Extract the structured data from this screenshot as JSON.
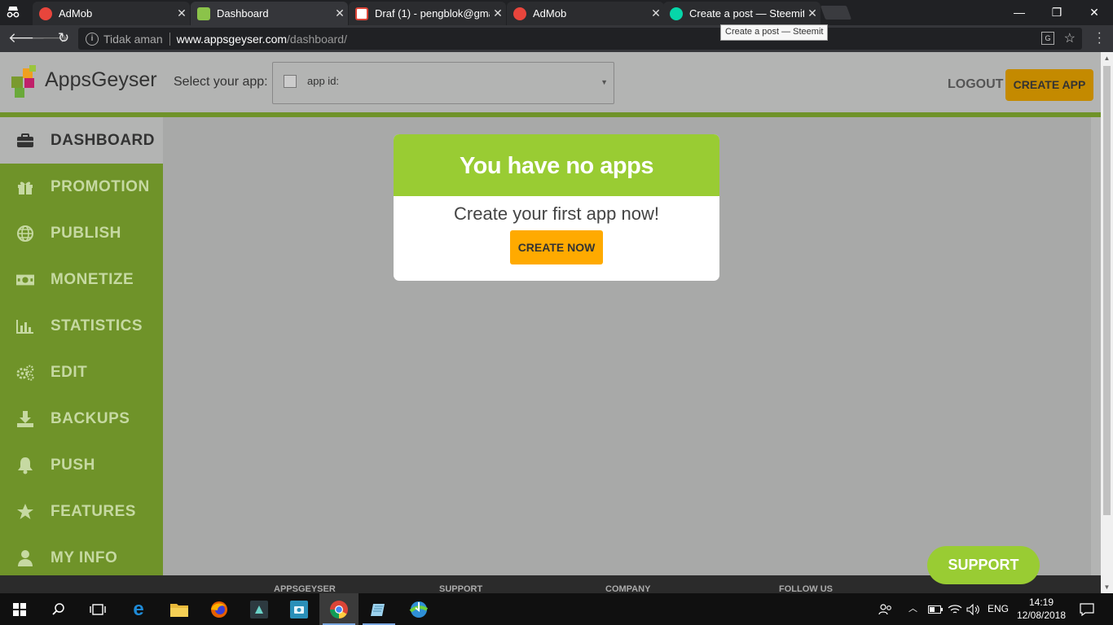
{
  "browser": {
    "tabs": [
      {
        "title": "AdMob",
        "fav_color": "#e8453c"
      },
      {
        "title": "Dashboard",
        "fav_color": "#8bc34a"
      },
      {
        "title": "Draf (1) - pengblok@gma",
        "fav_color": "#db4437"
      },
      {
        "title": "AdMob",
        "fav_color": "#e8453c"
      },
      {
        "title": "Create a post — Steemit",
        "fav_color": "#06d6a9"
      }
    ],
    "tooltip": "Create a post — Steemit",
    "security_text": "Tidak aman",
    "url_host": "www.appsgeyser.com",
    "url_path": "/dashboard/",
    "window_controls": {
      "minimize": "—",
      "restore": "❐",
      "close": "✕"
    }
  },
  "header": {
    "brand": "AppsGeyser",
    "select_label": "Select your app:",
    "select_value": "app id:",
    "logout": "LOGOUT",
    "create_app": "CREATE APP"
  },
  "sidebar": {
    "items": [
      {
        "label": "DASHBOARD",
        "icon": "briefcase-icon"
      },
      {
        "label": "PROMOTION",
        "icon": "gift-icon"
      },
      {
        "label": "PUBLISH",
        "icon": "globe-icon"
      },
      {
        "label": "MONETIZE",
        "icon": "money-icon"
      },
      {
        "label": "STATISTICS",
        "icon": "bar-chart-icon"
      },
      {
        "label": "EDIT",
        "icon": "gears-icon"
      },
      {
        "label": "BACKUPS",
        "icon": "download-icon"
      },
      {
        "label": "PUSH",
        "icon": "bell-icon"
      },
      {
        "label": "FEATURES",
        "icon": "star-icon"
      },
      {
        "label": "MY INFO",
        "icon": "user-icon"
      }
    ]
  },
  "modal": {
    "title": "You have no apps",
    "subtitle": "Create your first app now!",
    "button": "CREATE NOW"
  },
  "support_button": "SUPPORT",
  "footer": {
    "columns": [
      "APPSGEYSER",
      "SUPPORT",
      "COMPANY",
      "FOLLOW US"
    ]
  },
  "taskbar": {
    "language": "ENG",
    "time": "14:19",
    "date": "12/08/2018"
  },
  "colors": {
    "green": "#6f9329",
    "lime": "#99cc33",
    "orange": "#ffaa00",
    "page_gray": "#b3b4b3"
  }
}
